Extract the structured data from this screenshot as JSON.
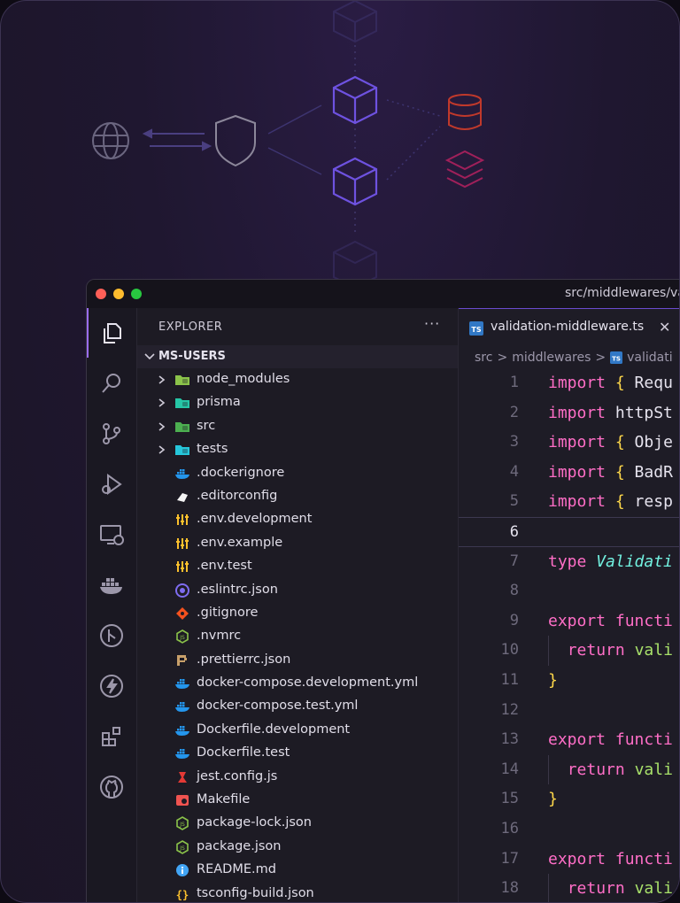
{
  "window": {
    "title": "src/middlewares/va"
  },
  "explorer": {
    "title": "EXPLORER",
    "more": "···",
    "project": "MS-USERS",
    "items": [
      {
        "name": "node_modules",
        "folder": true,
        "icon": "node-folder-icon",
        "color": "#8bc34a"
      },
      {
        "name": "prisma",
        "folder": true,
        "icon": "prisma-folder-icon",
        "color": "#26c6a6"
      },
      {
        "name": "src",
        "folder": true,
        "icon": "src-folder-icon",
        "color": "#4caf50"
      },
      {
        "name": "tests",
        "folder": true,
        "icon": "tests-folder-icon",
        "color": "#26c6da"
      },
      {
        "name": ".dockerignore",
        "icon": "docker-icon",
        "color": "#2496ed"
      },
      {
        "name": ".editorconfig",
        "icon": "editorconfig-icon",
        "color": "#f5f5f5"
      },
      {
        "name": ".env.development",
        "icon": "env-icon",
        "color": "#fbc02d"
      },
      {
        "name": ".env.example",
        "icon": "env-icon",
        "color": "#fbc02d"
      },
      {
        "name": ".env.test",
        "icon": "env-icon",
        "color": "#fbc02d"
      },
      {
        "name": ".eslintrc.json",
        "icon": "eslint-icon",
        "color": "#7e6cf0"
      },
      {
        "name": ".gitignore",
        "icon": "git-icon",
        "color": "#f4511e"
      },
      {
        "name": ".nvmrc",
        "icon": "nodejs-icon",
        "color": "#8bc34a"
      },
      {
        "name": ".prettierrc.json",
        "icon": "prettier-icon",
        "color": "#c8a06a"
      },
      {
        "name": "docker-compose.development.yml",
        "icon": "docker-icon",
        "color": "#2496ed"
      },
      {
        "name": "docker-compose.test.yml",
        "icon": "docker-icon",
        "color": "#2496ed"
      },
      {
        "name": "Dockerfile.development",
        "icon": "docker-icon",
        "color": "#2496ed"
      },
      {
        "name": "Dockerfile.test",
        "icon": "docker-icon",
        "color": "#2496ed"
      },
      {
        "name": "jest.config.js",
        "icon": "jest-icon",
        "color": "#e53935"
      },
      {
        "name": "Makefile",
        "icon": "makefile-icon",
        "color": "#ef5350"
      },
      {
        "name": "package-lock.json",
        "icon": "nodejs-icon",
        "color": "#8bc34a"
      },
      {
        "name": "package.json",
        "icon": "nodejs-icon",
        "color": "#8bc34a"
      },
      {
        "name": "README.md",
        "icon": "info-icon",
        "color": "#42a5f5"
      },
      {
        "name": "tsconfig-build.json",
        "icon": "tsconfig-icon",
        "color": "#fbc02d"
      }
    ]
  },
  "editor": {
    "tab": {
      "label": "validation-middleware.ts",
      "close": "✕",
      "badge": "TS"
    },
    "breadcrumb": {
      "part1": "src",
      "part2": "middlewares",
      "part3": "validati",
      "sep": ">"
    },
    "current_line": 6,
    "lines": [
      {
        "n": "1",
        "tokens": [
          {
            "t": "import",
            "c": "kw"
          },
          {
            "t": " "
          },
          {
            "t": "{",
            "c": "br"
          },
          {
            "t": " Requ"
          }
        ]
      },
      {
        "n": "2",
        "tokens": [
          {
            "t": "import",
            "c": "kw"
          },
          {
            "t": " httpSt"
          }
        ]
      },
      {
        "n": "3",
        "tokens": [
          {
            "t": "import",
            "c": "kw"
          },
          {
            "t": " "
          },
          {
            "t": "{",
            "c": "br"
          },
          {
            "t": " Obje"
          }
        ]
      },
      {
        "n": "4",
        "tokens": [
          {
            "t": "import",
            "c": "kw"
          },
          {
            "t": " "
          },
          {
            "t": "{",
            "c": "br"
          },
          {
            "t": " BadR"
          }
        ]
      },
      {
        "n": "5",
        "tokens": [
          {
            "t": "import",
            "c": "kw"
          },
          {
            "t": " "
          },
          {
            "t": "{",
            "c": "br"
          },
          {
            "t": " resp"
          }
        ]
      },
      {
        "n": "6",
        "tokens": []
      },
      {
        "n": "7",
        "tokens": [
          {
            "t": "type",
            "c": "kw"
          },
          {
            "t": " "
          },
          {
            "t": "Validati",
            "c": "ty"
          }
        ]
      },
      {
        "n": "8",
        "tokens": []
      },
      {
        "n": "9",
        "tokens": [
          {
            "t": "export",
            "c": "kw"
          },
          {
            "t": " "
          },
          {
            "t": "functi",
            "c": "kw"
          }
        ]
      },
      {
        "n": "10",
        "indent": true,
        "tokens": [
          {
            "t": "  "
          },
          {
            "t": "return",
            "c": "kw"
          },
          {
            "t": " "
          },
          {
            "t": "vali",
            "c": "fn"
          }
        ]
      },
      {
        "n": "11",
        "tokens": [
          {
            "t": "}",
            "c": "br"
          }
        ]
      },
      {
        "n": "12",
        "tokens": []
      },
      {
        "n": "13",
        "tokens": [
          {
            "t": "export",
            "c": "kw"
          },
          {
            "t": " "
          },
          {
            "t": "functi",
            "c": "kw"
          }
        ]
      },
      {
        "n": "14",
        "indent": true,
        "tokens": [
          {
            "t": "  "
          },
          {
            "t": "return",
            "c": "kw"
          },
          {
            "t": " "
          },
          {
            "t": "vali",
            "c": "fn"
          }
        ]
      },
      {
        "n": "15",
        "tokens": [
          {
            "t": "}",
            "c": "br"
          }
        ]
      },
      {
        "n": "16",
        "tokens": []
      },
      {
        "n": "17",
        "tokens": [
          {
            "t": "export",
            "c": "kw"
          },
          {
            "t": " "
          },
          {
            "t": "functi",
            "c": "kw"
          }
        ]
      },
      {
        "n": "18",
        "indent": true,
        "tokens": [
          {
            "t": "  "
          },
          {
            "t": "return",
            "c": "kw"
          },
          {
            "t": " "
          },
          {
            "t": "vali",
            "c": "fn"
          }
        ]
      }
    ]
  },
  "activity_bar": [
    "explorer-icon",
    "search-icon",
    "source-control-icon",
    "run-debug-icon",
    "remote-explorer-icon",
    "docker-icon",
    "git-graph-icon",
    "thunder-client-icon",
    "extensions-icon",
    "github-icon"
  ],
  "colors": {
    "accent": "#9a6cf0",
    "keyword": "#ff6ec7",
    "bracket": "#ffd84a",
    "type": "#72f1e0",
    "function": "#a8e06a"
  }
}
